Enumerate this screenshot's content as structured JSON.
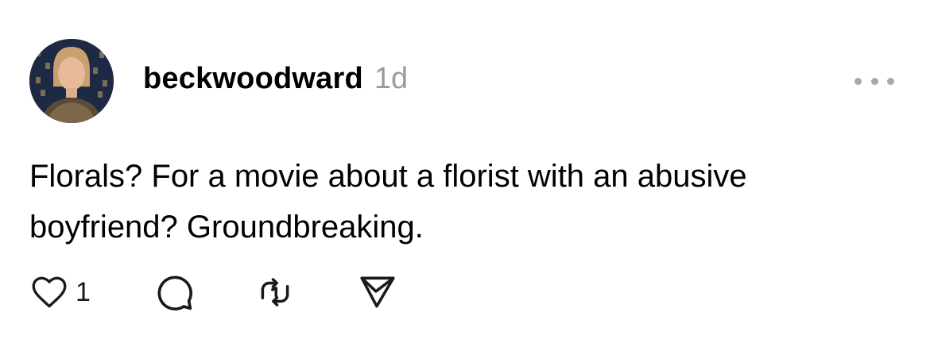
{
  "post": {
    "username": "beckwoodward",
    "timestamp": "1d",
    "text": "Florals? For a movie about a florist with an abusive boyfriend? Groundbreaking.",
    "like_count": "1"
  },
  "icons": {
    "more": "more-horizontal-icon",
    "like": "heart-icon",
    "reply": "comment-bubble-icon",
    "repost": "repost-icon",
    "share": "send-icon"
  },
  "colors": {
    "timestamp": "#9b9b9b",
    "text": "#000000",
    "icon_stroke": "#1a1a1a",
    "more_dots": "#a8a8a8"
  }
}
